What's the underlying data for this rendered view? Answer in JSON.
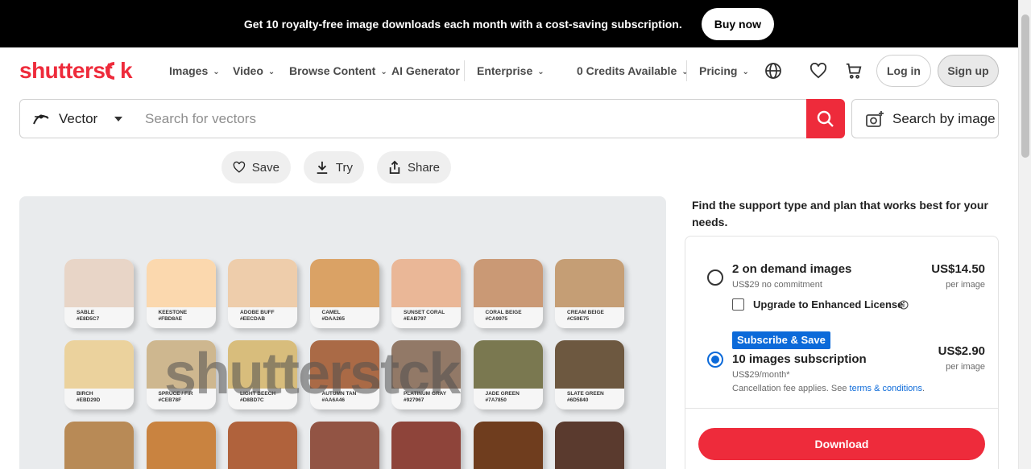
{
  "promo": {
    "text": "Get 10 royalty-free image downloads each month with a cost-saving subscription.",
    "button": "Buy now"
  },
  "brand": {
    "logo": "shutterstck",
    "accent": "#ee2b3b",
    "link_color": "#0c6ad9"
  },
  "nav": {
    "items": [
      {
        "label": "Images"
      },
      {
        "label": "Video"
      },
      {
        "label": "Browse Content"
      },
      {
        "label": "AI Generator"
      },
      {
        "label": "Enterprise"
      },
      {
        "label": "0 Credits Available"
      },
      {
        "label": "Pricing"
      }
    ],
    "icons": [
      "globe-icon",
      "heart-icon",
      "cart-icon"
    ],
    "login": "Log in",
    "signup": "Sign up"
  },
  "search": {
    "type": "Vector",
    "placeholder": "Search for vectors",
    "by_image": "Search by image"
  },
  "actions": {
    "save": "Save",
    "try": "Try",
    "share": "Share"
  },
  "preview": {
    "watermark": "shutterstck",
    "swatches": [
      {
        "name": "SABLE",
        "hex": "#E8D5C7",
        "color": "#e8d5c7"
      },
      {
        "name": "KEESTONE",
        "hex": "#FBD8AE",
        "color": "#fbd8ae"
      },
      {
        "name": "ADOBE BUFF",
        "hex": "#EECDAB",
        "color": "#eecdab"
      },
      {
        "name": "CAMEL",
        "hex": "#DAA265",
        "color": "#daa265"
      },
      {
        "name": "SUNSET CORAL",
        "hex": "#EAB797",
        "color": "#eab797"
      },
      {
        "name": "CORAL BEIGE",
        "hex": "#CA9975",
        "color": "#ca9975"
      },
      {
        "name": "CREAM BEIGE",
        "hex": "#C59E75",
        "color": "#c59e75"
      },
      {
        "name": "BIRCH",
        "hex": "#EBD29D",
        "color": "#ebd29d"
      },
      {
        "name": "SPRUCE / FIR",
        "hex": "#CEB78F",
        "color": "#ceb78f"
      },
      {
        "name": "LIGHT BEECH",
        "hex": "#D8BD7C",
        "color": "#d8bd7c"
      },
      {
        "name": "AUTUMN TAN",
        "hex": "#AA6A46",
        "color": "#aa6a46"
      },
      {
        "name": "PLATINUM GRAY",
        "hex": "#927967",
        "color": "#927967"
      },
      {
        "name": "JADE GREEN",
        "hex": "#7A7850",
        "color": "#7a7850"
      },
      {
        "name": "SLATE GREEN",
        "hex": "#6D5840",
        "color": "#6d5840"
      },
      {
        "name": "",
        "hex": "",
        "color": "#b88a56"
      },
      {
        "name": "",
        "hex": "",
        "color": "#c98340"
      },
      {
        "name": "",
        "hex": "",
        "color": "#b0623c"
      },
      {
        "name": "",
        "hex": "",
        "color": "#925444"
      },
      {
        "name": "",
        "hex": "",
        "color": "#8e443a"
      },
      {
        "name": "",
        "hex": "",
        "color": "#6f3d1e"
      },
      {
        "name": "",
        "hex": "",
        "color": "#5a3a2e"
      }
    ]
  },
  "plans": {
    "heading": "Find the support type and plan that works best for your needs.",
    "on_demand": {
      "title": "2 on demand images",
      "subtitle": "US$29 no commitment",
      "price": "US$14.50",
      "per": "per image",
      "enhanced": "Upgrade to Enhanced License",
      "selected": false
    },
    "subscription": {
      "badge": "Subscribe & Save",
      "title": "10 images subscription",
      "subtitle": "US$29/month*",
      "fee_note": "Cancellation fee applies. See",
      "fee_link": "terms & conditions",
      "fee_end": ".",
      "price": "US$2.90",
      "per": "per image",
      "selected": true
    },
    "download": "Download"
  }
}
